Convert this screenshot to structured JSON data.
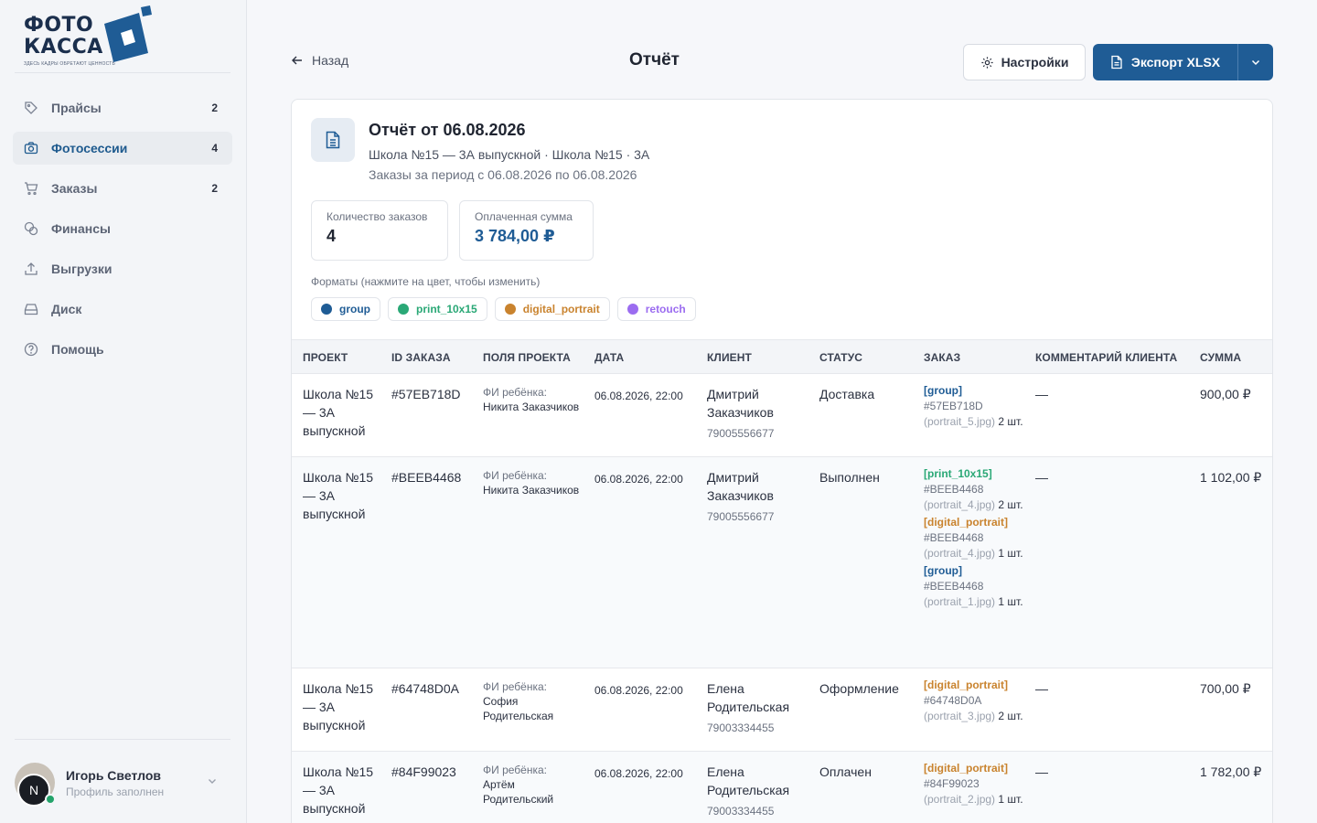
{
  "brand": {
    "line1": "ФОТО",
    "line2": "КАССА",
    "tagline": "ЗДЕСЬ КАДРЫ ОБРЕТАЮТ ЦЕННОСТЬ",
    "color": "#1f5c95"
  },
  "sidebar": {
    "items": [
      {
        "label": "Прайсы",
        "count": "2",
        "icon": "tag-icon"
      },
      {
        "label": "Фотосессии",
        "count": "4",
        "icon": "camera-icon",
        "active": true
      },
      {
        "label": "Заказы",
        "count": "2",
        "icon": "cart-icon"
      },
      {
        "label": "Финансы",
        "count": "",
        "icon": "coins-icon"
      },
      {
        "label": "Выгрузки",
        "count": "",
        "icon": "upload-icon"
      },
      {
        "label": "Диск",
        "count": "",
        "icon": "drive-icon"
      },
      {
        "label": "Помощь",
        "count": "",
        "icon": "help-icon"
      }
    ]
  },
  "user": {
    "name": "Игорь Светлов",
    "status": "Профиль заполнен",
    "initial": "N"
  },
  "header": {
    "back_label": "Назад",
    "title": "Отчёт",
    "settings_label": "Настройки",
    "export_label": "Экспорт XLSX"
  },
  "report": {
    "title": "Отчёт от 06.08.2026",
    "subtitle": "Школа №15 — 3А выпускной · Школа №15 · 3А",
    "period": "Заказы за период с 06.08.2026 по 06.08.2026",
    "stats": {
      "orders_label": "Количество заказов",
      "orders_value": "4",
      "paid_label": "Оплаченная сумма",
      "paid_value": "3 784,00 ₽"
    },
    "formats_label": "Форматы (нажмите на цвет, чтобы изменить)",
    "formats": [
      {
        "name": "group",
        "color": "#1f5c95"
      },
      {
        "name": "print_10x15",
        "color": "#2aa876"
      },
      {
        "name": "digital_portrait",
        "color": "#c9832e"
      },
      {
        "name": "retouch",
        "color": "#9b6cf0"
      }
    ]
  },
  "table": {
    "columns": [
      "ПРОЕКТ",
      "ID ЗАКАЗА",
      "ПОЛЯ ПРОЕКТА",
      "ДАТА",
      "КЛИЕНТ",
      "СТАТУС",
      "ЗАКАЗ",
      "КОММЕНТАРИЙ КЛИЕНТА",
      "СУММА"
    ],
    "rows": [
      {
        "project": "Школа №15 — 3А выпускной",
        "id": "#57EB718D",
        "field_label": "ФИ ребёнка:",
        "field_value": "Никита Заказчиков",
        "date": "06.08.2026, 22:00",
        "client": "Дмитрий Заказчиков",
        "phone": "79005556677",
        "status": "Доставка",
        "items": [
          {
            "format": "[group]",
            "color": "#1f5c95",
            "oid": "#57EB718D",
            "file": "(portrait_5.jpg)",
            "qty": "2 шт."
          }
        ],
        "comment": "—",
        "sum": "900,00 ₽"
      },
      {
        "project": "Школа №15 — 3А выпускной",
        "id": "#BEEB4468",
        "field_label": "ФИ ребёнка:",
        "field_value": "Никита Заказчиков",
        "date": "06.08.2026, 22:00",
        "client": "Дмитрий Заказчиков",
        "phone": "79005556677",
        "status": "Выполнен",
        "items": [
          {
            "format": "[print_10x15]",
            "color": "#2aa876",
            "oid": "#BEEB4468",
            "file": "(portrait_4.jpg)",
            "qty": "2 шт."
          },
          {
            "format": "[digital_portrait]",
            "color": "#c9832e",
            "oid": "#BEEB4468",
            "file": "(portrait_4.jpg)",
            "qty": "1 шт."
          },
          {
            "format": "[group]",
            "color": "#1f5c95",
            "oid": "#BEEB4468",
            "file": "(portrait_1.jpg)",
            "qty": "1 шт."
          }
        ],
        "comment": "—",
        "sum": "1 102,00 ₽"
      },
      {
        "project": "Школа №15 — 3А выпускной",
        "id": "#64748D0A",
        "field_label": "ФИ ребёнка:",
        "field_value": "София Родительская",
        "date": "06.08.2026, 22:00",
        "client": "Елена Родительская",
        "phone": "79003334455",
        "status": "Оформление",
        "items": [
          {
            "format": "[digital_portrait]",
            "color": "#c9832e",
            "oid": "#64748D0A",
            "file": "(portrait_3.jpg)",
            "qty": "2 шт."
          }
        ],
        "comment": "—",
        "sum": "700,00 ₽"
      },
      {
        "project": "Школа №15 — 3А выпускной",
        "id": "#84F99023",
        "field_label": "ФИ ребёнка:",
        "field_value": "Артём Родительский",
        "date": "06.08.2026, 22:00",
        "client": "Елена Родительская",
        "phone": "79003334455",
        "status": "Оплачен",
        "items": [
          {
            "format": "[digital_portrait]",
            "color": "#c9832e",
            "oid": "#84F99023",
            "file": "(portrait_2.jpg)",
            "qty": "1 шт."
          }
        ],
        "comment": "—",
        "sum": "1 782,00 ₽"
      }
    ]
  }
}
